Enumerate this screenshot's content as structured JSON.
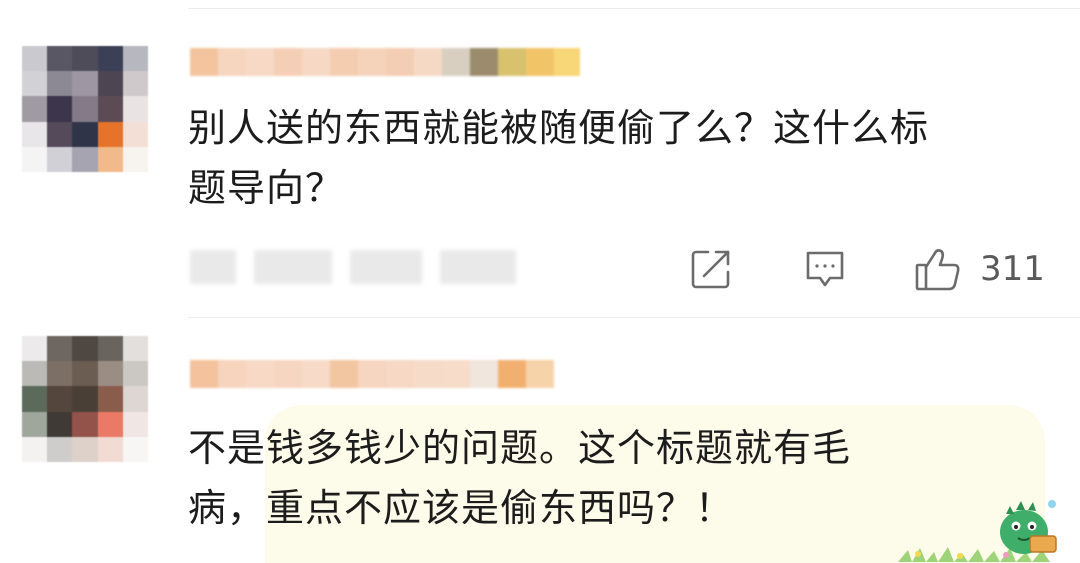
{
  "comments": [
    {
      "text": "别人送的东西就能被随便偷了么？这什么标\n题导向？",
      "actions": {
        "share_icon": "share-icon",
        "reply_icon": "comment-icon",
        "like_icon": "thumbs-up-icon",
        "like_count": "311"
      }
    },
    {
      "text": "不是钱多钱少的问题。这个标题就有毛\n病，重点不应该是偷东西吗？！",
      "decoration": "dinosaur-mascot-sticker"
    }
  ]
}
